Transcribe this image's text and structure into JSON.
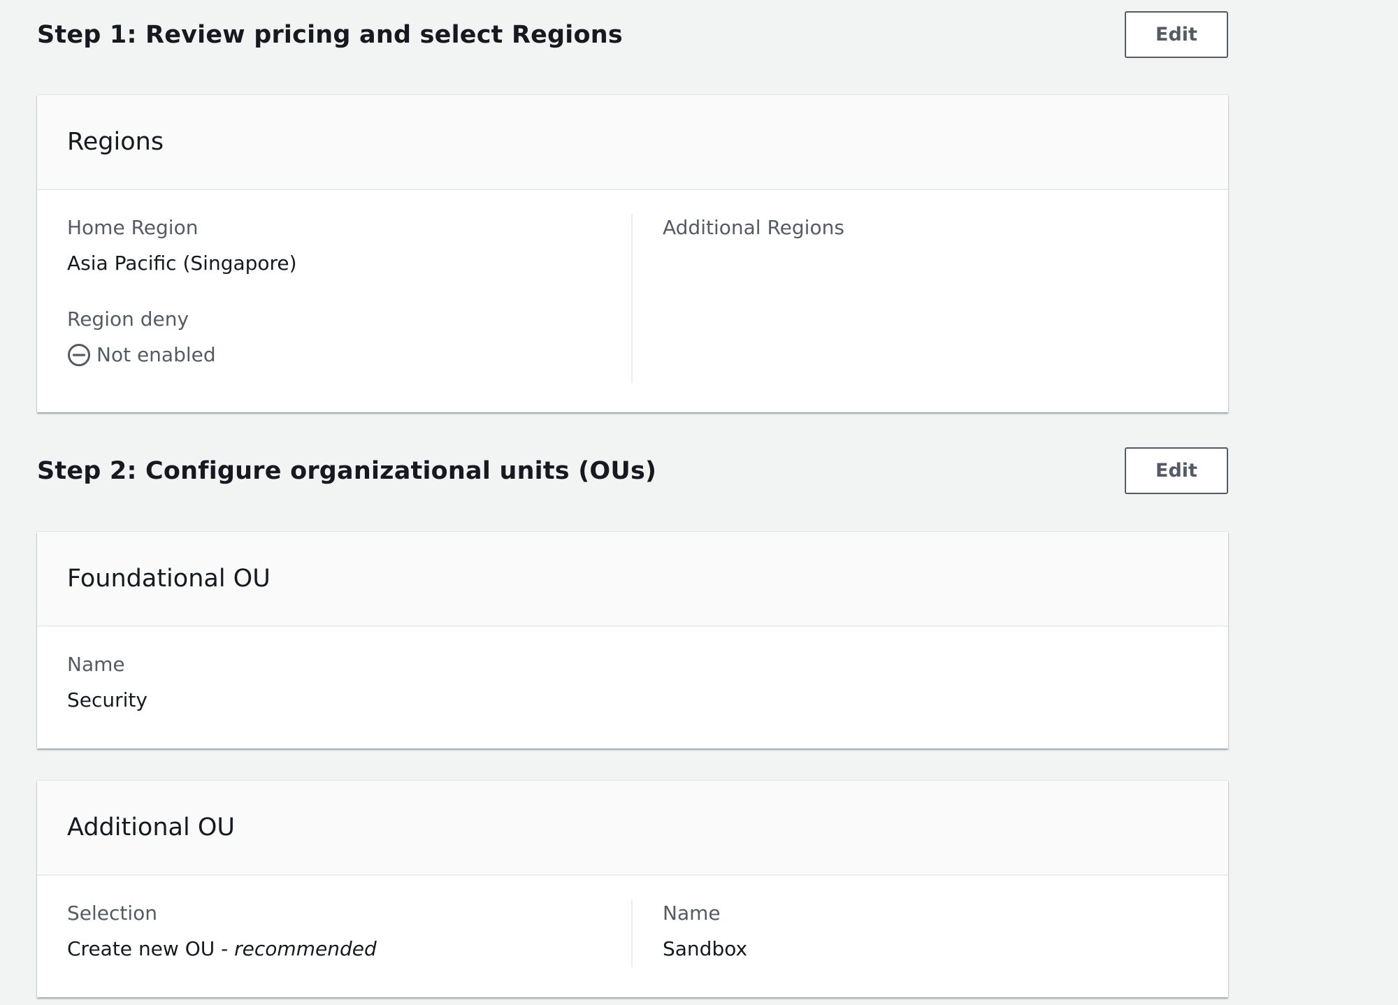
{
  "step1": {
    "title": "Step 1: Review pricing and select Regions",
    "edit_label": "Edit",
    "regions_card": {
      "title": "Regions",
      "home_region_label": "Home Region",
      "home_region_value": "Asia Pacific (Singapore)",
      "region_deny_label": "Region deny",
      "region_deny_value": "Not enabled",
      "region_deny_icon": "minus-circle-icon",
      "additional_regions_label": "Additional Regions",
      "additional_regions_value": ""
    }
  },
  "step2": {
    "title": "Step 2: Configure organizational units (OUs)",
    "edit_label": "Edit",
    "foundational_card": {
      "title": "Foundational OU",
      "name_label": "Name",
      "name_value": "Security"
    },
    "additional_card": {
      "title": "Additional OU",
      "selection_label": "Selection",
      "selection_value": "Create new OU - ",
      "selection_value_emphasis": "recommended",
      "name_label": "Name",
      "name_value": "Sandbox"
    }
  },
  "colors": {
    "page_background": "#f2f3f3",
    "card_background": "#ffffff",
    "card_header_background": "#fafafa",
    "text_primary": "#16191f",
    "text_secondary": "#545b64",
    "divider": "#eaeded"
  }
}
